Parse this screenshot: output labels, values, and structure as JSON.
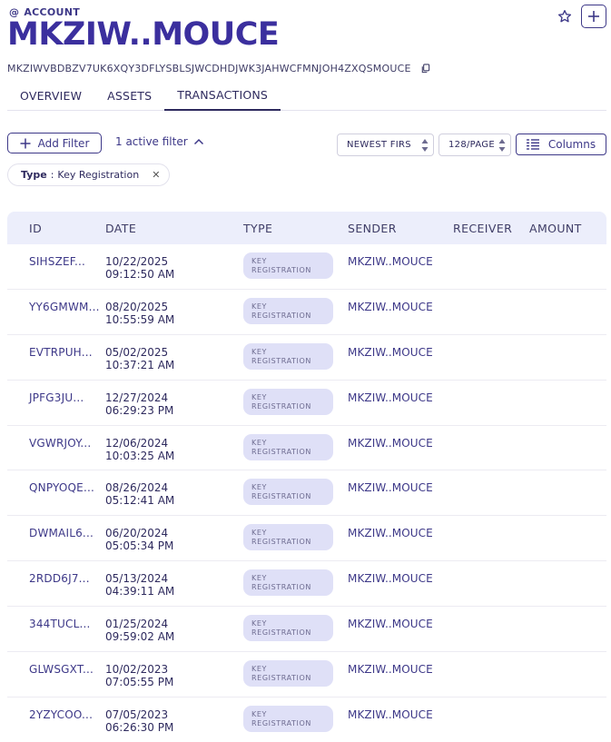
{
  "header": {
    "account_label": "ACCOUNT",
    "title": "MKZIW..MOUCE",
    "address": "MKZIWVBDBZV7UK6XQY3DFLYSBLSJWCDHDJWK3JAHWCFMNJOH4ZXQSMOUCE"
  },
  "tabs": [
    {
      "label": "OVERVIEW",
      "active": false
    },
    {
      "label": "ASSETS",
      "active": false
    },
    {
      "label": "TRANSACTIONS",
      "active": true
    }
  ],
  "toolbar": {
    "add_filter_label": "Add Filter",
    "active_filter_label": "1 active filter",
    "sort_value": "NEWEST FIRS",
    "page_size_value": "128/PAGE",
    "columns_label": "Columns"
  },
  "filter_chip": {
    "key": "Type",
    "separator": ":",
    "value": "Key Registration"
  },
  "table": {
    "columns": [
      "ID",
      "DATE",
      "TYPE",
      "SENDER",
      "RECEIVER",
      "AMOUNT"
    ],
    "rows": [
      {
        "id": "SIHSZEF...",
        "date": "10/22/2025",
        "time": "09:12:50 AM",
        "type": "KEY REGISTRATION",
        "sender": "MKZIW..MOUCE"
      },
      {
        "id": "YY6GMWM...",
        "date": "08/20/2025",
        "time": "10:55:59 AM",
        "type": "KEY REGISTRATION",
        "sender": "MKZIW..MOUCE"
      },
      {
        "id": "EVTRPUH...",
        "date": "05/02/2025",
        "time": "10:37:21 AM",
        "type": "KEY REGISTRATION",
        "sender": "MKZIW..MOUCE"
      },
      {
        "id": "JPFG3JU...",
        "date": "12/27/2024",
        "time": "06:29:23 PM",
        "type": "KEY REGISTRATION",
        "sender": "MKZIW..MOUCE"
      },
      {
        "id": "VGWRJOY...",
        "date": "12/06/2024",
        "time": "10:03:25 AM",
        "type": "KEY REGISTRATION",
        "sender": "MKZIW..MOUCE"
      },
      {
        "id": "QNPYOQE...",
        "date": "08/26/2024",
        "time": "05:12:41 AM",
        "type": "KEY REGISTRATION",
        "sender": "MKZIW..MOUCE"
      },
      {
        "id": "DWMAIL6...",
        "date": "06/20/2024",
        "time": "05:05:34 PM",
        "type": "KEY REGISTRATION",
        "sender": "MKZIW..MOUCE"
      },
      {
        "id": "2RDD6J7...",
        "date": "05/13/2024",
        "time": "04:39:11 AM",
        "type": "KEY REGISTRATION",
        "sender": "MKZIW..MOUCE"
      },
      {
        "id": "344TUCL...",
        "date": "01/25/2024",
        "time": "09:59:02 AM",
        "type": "KEY REGISTRATION",
        "sender": "MKZIW..MOUCE"
      },
      {
        "id": "GLWSGXT...",
        "date": "10/02/2023",
        "time": "07:05:55 PM",
        "type": "KEY REGISTRATION",
        "sender": "MKZIW..MOUCE"
      },
      {
        "id": "2YZYCOO...",
        "date": "07/05/2023",
        "time": "06:26:30 PM",
        "type": "KEY REGISTRATION",
        "sender": "MKZIW..MOUCE"
      }
    ]
  },
  "icons": {
    "account": "at-icon",
    "favorite": "star-icon",
    "add": "plus-icon",
    "copy": "copy-icon",
    "add_filter": "plus-icon",
    "collapse": "chevron-up-icon",
    "columns": "columns-icon",
    "remove_chip": "close-icon"
  },
  "colors": {
    "accent": "#3b2f9e",
    "header_bg": "#eceefb",
    "badge_bg": "#dfe0f7"
  }
}
